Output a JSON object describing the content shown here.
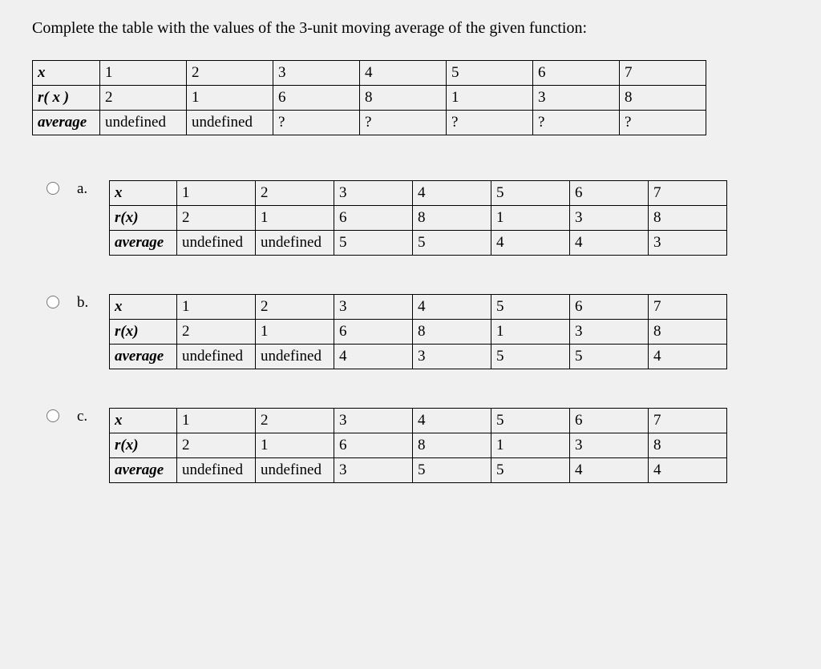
{
  "prompt": "Complete the table with the values of the 3-unit moving average of the given function:",
  "main": {
    "labels": {
      "x": "x",
      "rx": "r( x )",
      "avg": "average"
    },
    "x": [
      "1",
      "2",
      "3",
      "4",
      "5",
      "6",
      "7"
    ],
    "rx": [
      "2",
      "1",
      "6",
      "8",
      "1",
      "3",
      "8"
    ],
    "avg": [
      "undefined",
      "undefined",
      "?",
      "?",
      "?",
      "?",
      "?"
    ]
  },
  "options": [
    {
      "letter": "a.",
      "labels": {
        "x": "x",
        "rx": "r(x)",
        "avg": "average"
      },
      "x": [
        "1",
        "2",
        "3",
        "4",
        "5",
        "6",
        "7"
      ],
      "rx": [
        "2",
        "1",
        "6",
        "8",
        "1",
        "3",
        "8"
      ],
      "avg": [
        "undefined",
        "undefined",
        "5",
        "5",
        "4",
        "4",
        "3"
      ]
    },
    {
      "letter": "b.",
      "labels": {
        "x": "x",
        "rx": "r(x)",
        "avg": "average"
      },
      "x": [
        "1",
        "2",
        "3",
        "4",
        "5",
        "6",
        "7"
      ],
      "rx": [
        "2",
        "1",
        "6",
        "8",
        "1",
        "3",
        "8"
      ],
      "avg": [
        "undefined",
        "undefined",
        "4",
        "3",
        "5",
        "5",
        "4"
      ]
    },
    {
      "letter": "c.",
      "labels": {
        "x": "x",
        "rx": "r(x)",
        "avg": "average"
      },
      "x": [
        "1",
        "2",
        "3",
        "4",
        "5",
        "6",
        "7"
      ],
      "rx": [
        "2",
        "1",
        "6",
        "8",
        "1",
        "3",
        "8"
      ],
      "avg": [
        "undefined",
        "undefined",
        "3",
        "5",
        "5",
        "4",
        "4"
      ]
    }
  ]
}
